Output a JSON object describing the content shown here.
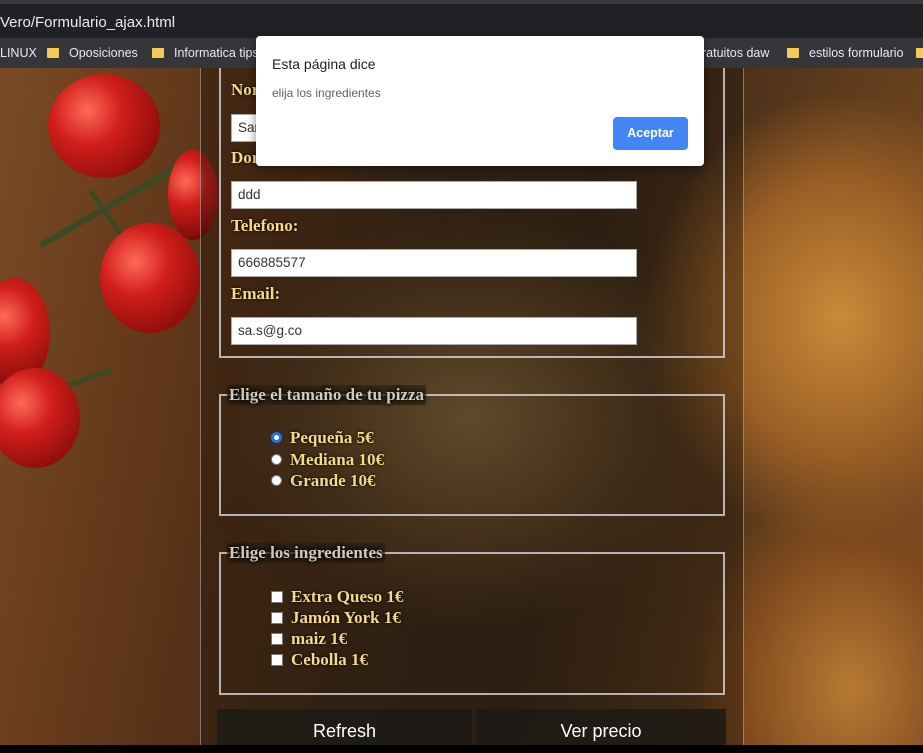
{
  "browser": {
    "url": "Vero/Formulario_ajax.html",
    "bookmarks": [
      {
        "label": "LINUX"
      },
      {
        "label": "Oposiciones"
      },
      {
        "label": "Informatica tips"
      },
      {
        "label": "ratuitos daw"
      },
      {
        "label": "estilos formulario"
      }
    ]
  },
  "dialog": {
    "title": "Esta página dice",
    "message": "elija los ingredientes",
    "ok_label": "Aceptar"
  },
  "form": {
    "personal": {
      "name_label_partial": "Nor",
      "name_value_partial": "Sar",
      "address_label_partial": "Dor",
      "address_value": "ddd",
      "phone_label": "Telefono:",
      "phone_value": "666885577",
      "email_label": "Email:",
      "email_value": "sa.s@g.co"
    },
    "size": {
      "legend": "Elige el tamaño de tu pizza",
      "options": [
        {
          "label": "Pequeña 5€",
          "checked": true
        },
        {
          "label": "Mediana 10€",
          "checked": false
        },
        {
          "label": "Grande 10€",
          "checked": false
        }
      ]
    },
    "ingredients": {
      "legend": "Elige los ingredientes",
      "options": [
        {
          "label": "Extra Queso 1€",
          "checked": false
        },
        {
          "label": "Jamón York 1€",
          "checked": false
        },
        {
          "label": "maiz 1€",
          "checked": false
        },
        {
          "label": "Cebolla 1€",
          "checked": false
        }
      ]
    },
    "buttons": {
      "refresh": "Refresh",
      "price": "Ver precio"
    }
  },
  "colors": {
    "label_gold": "#f4d98a",
    "dialog_button": "#4285f4",
    "radio_selected": "#1a73e8"
  }
}
